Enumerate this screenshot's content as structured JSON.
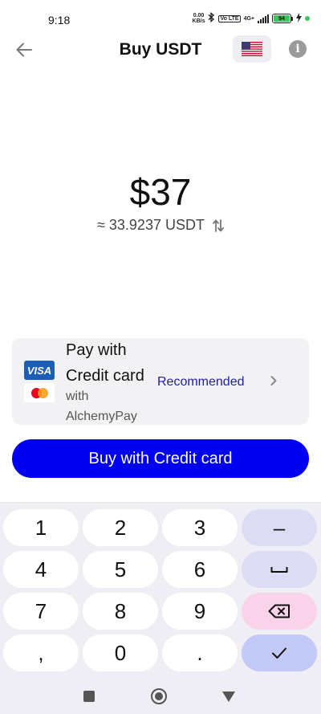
{
  "status_bar": {
    "time": "9:18",
    "net_speed_value": "0.00",
    "net_speed_unit": "KB/s",
    "volte": "Vo LTE",
    "network": "4G+",
    "battery": "94",
    "icons": [
      "bluetooth-icon",
      "signal-icon",
      "battery-icon",
      "charging-icon"
    ]
  },
  "header": {
    "title": "Buy USDT",
    "back_icon": "arrow-left-icon",
    "flag_icon": "us-flag-icon",
    "info_icon": "info-icon"
  },
  "amount": {
    "value": "$37",
    "conversion": "≈ 33.9237 USDT",
    "swap_icon": "swap-vertical-icon"
  },
  "payment_method": {
    "line1": "Pay with",
    "line2": "Credit card",
    "line3": "with",
    "line4": "AlchemyPay",
    "badge": "Recommended",
    "visa_label": "VISA",
    "icons": [
      "visa-logo",
      "mastercard-logo",
      "chevron-right-icon"
    ]
  },
  "buy_button": {
    "label": "Buy with Credit card"
  },
  "keypad": {
    "keys": [
      "1",
      "2",
      "3",
      "–",
      "4",
      "5",
      "6",
      "␣",
      "7",
      "8",
      "9",
      "⌫",
      ",",
      "0",
      ".",
      "✓"
    ]
  },
  "colors": {
    "primary": "#0000f0",
    "recommended_text": "#1e1ea0",
    "card_bg": "#f2f2f5",
    "keypad_bg": "#efeef5",
    "delete_key": "#f9d3e9",
    "done_key": "#c3c9f6"
  }
}
